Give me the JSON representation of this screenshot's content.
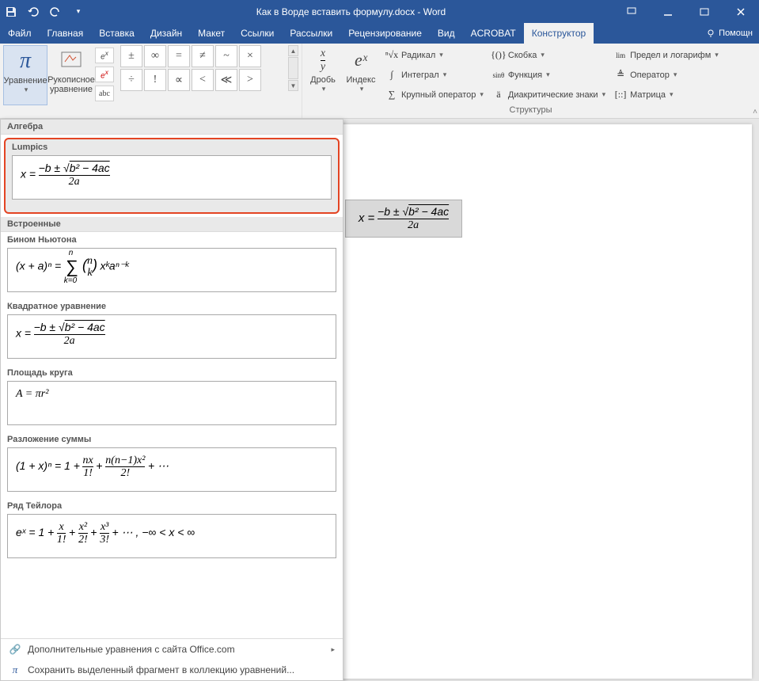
{
  "title": "Как в Ворде вставить формулу.docx - Word",
  "tabs": {
    "file": "Файл",
    "home": "Главная",
    "insert": "Вставка",
    "design": "Дизайн",
    "layout": "Макет",
    "references": "Ссылки",
    "mailings": "Рассылки",
    "review": "Рецензирование",
    "view": "Вид",
    "acrobat": "ACROBAT",
    "designer": "Конструктор",
    "help": "Помощн"
  },
  "ribbon": {
    "equation": "Уравнение",
    "ink": "Рукописное\nуравнение",
    "abc": "abc",
    "algebra": "Алгебра",
    "symbols_row1": [
      "±",
      "∞",
      "=",
      "≠",
      "~",
      "×"
    ],
    "symbols_row2": [
      "÷",
      "!",
      "∝",
      "<",
      "≪",
      ">"
    ],
    "fraction": "Дробь",
    "index": "Индекс",
    "radical": "Радикал",
    "integral": "Интеграл",
    "large_op": "Крупный оператор",
    "bracket": "Скобка",
    "function": "Функция",
    "diacritic": "Диакритические знаки",
    "limit": "Предел и логарифм",
    "operator": "Оператор",
    "matrix": "Матрица",
    "structures": "Структуры",
    "frac_icon_top": "x",
    "frac_icon_bot": "y",
    "index_icon": "eˣ"
  },
  "dropdown": {
    "cat_lumpics": "Lumpics",
    "cat_builtin": "Встроенные",
    "binom": "Бином Ньютона",
    "quadratic": "Квадратное уравнение",
    "circle": "Площадь круга",
    "expansion": "Разложение суммы",
    "taylor": "Ряд Тейлора",
    "more": "Дополнительные уравнения с сайта Office.com",
    "save": "Сохранить выделенный фрагмент в коллекцию уравнений...",
    "formulas": {
      "quad_x": "x =",
      "quad_num": "−b ± √",
      "quad_rad": "b² − 4ac",
      "quad_den": "2a",
      "binom_lhs": "(x + a)ⁿ =",
      "binom_sum_top": "n",
      "binom_sum_bot": "k=0",
      "binom_binom_top": "n",
      "binom_binom_bot": "k",
      "binom_rhs": "xᵏaⁿ⁻ᵏ",
      "circle_eq": "A = πr²",
      "exp_lhs": "(1 + x)ⁿ = 1 +",
      "exp_t1_num": "nx",
      "exp_t1_den": "1!",
      "exp_t2_num": "n(n−1)x²",
      "exp_t2_den": "2!",
      "exp_tail": "+ ⋯",
      "tay_lhs": "eˣ = 1 +",
      "tay_t1_num": "x",
      "tay_t1_den": "1!",
      "tay_t2_num": "x²",
      "tay_t2_den": "2!",
      "tay_t3_num": "x³",
      "tay_t3_den": "3!",
      "tay_tail": "+ ⋯ ,      −∞ < x < ∞"
    }
  },
  "doc_equation": {
    "x": "x =",
    "num_a": "−b ± √",
    "num_rad": "b² − 4ac",
    "den": "2a"
  }
}
